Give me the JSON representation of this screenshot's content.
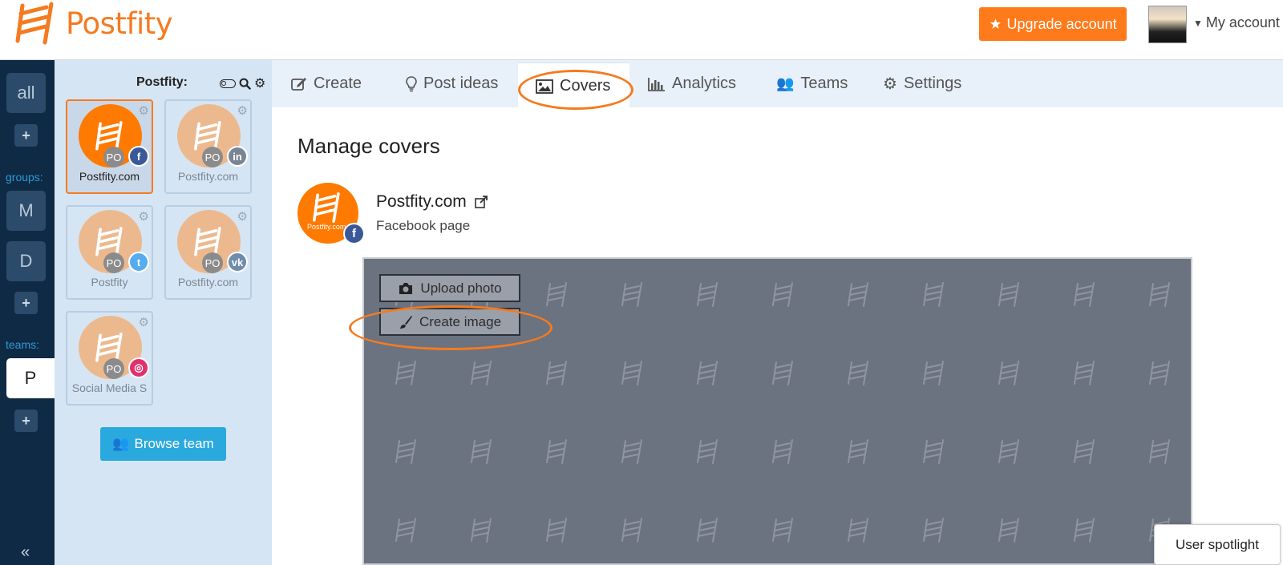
{
  "header": {
    "logo_text": "Postfity",
    "upgrade_label": "Upgrade account",
    "account_label": "My account",
    "icons": {
      "upgrade": "star-icon",
      "account": "caret-down-icon"
    }
  },
  "rail": {
    "all_label": "all",
    "groups_label": "groups:",
    "group_items": [
      "M",
      "D"
    ],
    "teams_label": "teams:",
    "team_items": [
      "P"
    ],
    "plus_label": "+",
    "collapse_label": "«"
  },
  "profiles": {
    "title": "Postfity:",
    "cards": [
      {
        "name": "Postfity.com",
        "badge": "PO",
        "network": "facebook",
        "network_glyph": "f",
        "network_color": "#3b5998",
        "selected": true
      },
      {
        "name": "Postfity.com",
        "badge": "PO",
        "network": "linkedin",
        "network_glyph": "in",
        "network_color": "#7a8593",
        "selected": false
      },
      {
        "name": "Postfity",
        "badge": "PO",
        "network": "twitter",
        "network_glyph": "t",
        "network_color": "#55acee",
        "selected": false
      },
      {
        "name": "Postfity.com",
        "badge": "PO",
        "network": "vk",
        "network_glyph": "vk",
        "network_color": "#6f8bad",
        "selected": false
      },
      {
        "name": "Social Media S",
        "badge": "PO",
        "network": "instagram",
        "network_glyph": "◎",
        "network_color": "#e1306c",
        "selected": false
      }
    ],
    "browse_label": "Browse team"
  },
  "tabs": [
    {
      "label": "Create",
      "icon": "edit-icon",
      "active": false
    },
    {
      "label": "Post ideas",
      "icon": "lightbulb-icon",
      "active": false
    },
    {
      "label": "Covers",
      "icon": "image-icon",
      "active": true
    },
    {
      "label": "Analytics",
      "icon": "bar-chart-icon",
      "active": false
    },
    {
      "label": "Teams",
      "icon": "users-icon",
      "active": false
    },
    {
      "label": "Settings",
      "icon": "gears-icon",
      "active": false
    }
  ],
  "main": {
    "title": "Manage covers",
    "page_name": "Postfity.com",
    "page_type": "Facebook page",
    "page_avatar_text": "Postfity.com",
    "upload_label": "Upload photo",
    "create_label": "Create image"
  },
  "spotlight_label": "User spotlight",
  "colors": {
    "brand_orange": "#f47b20",
    "rail_bg": "#0f2a45",
    "panel_bg": "#d6e5f3",
    "cover_bg": "#6b7280",
    "browse_blue": "#2aa9de"
  }
}
